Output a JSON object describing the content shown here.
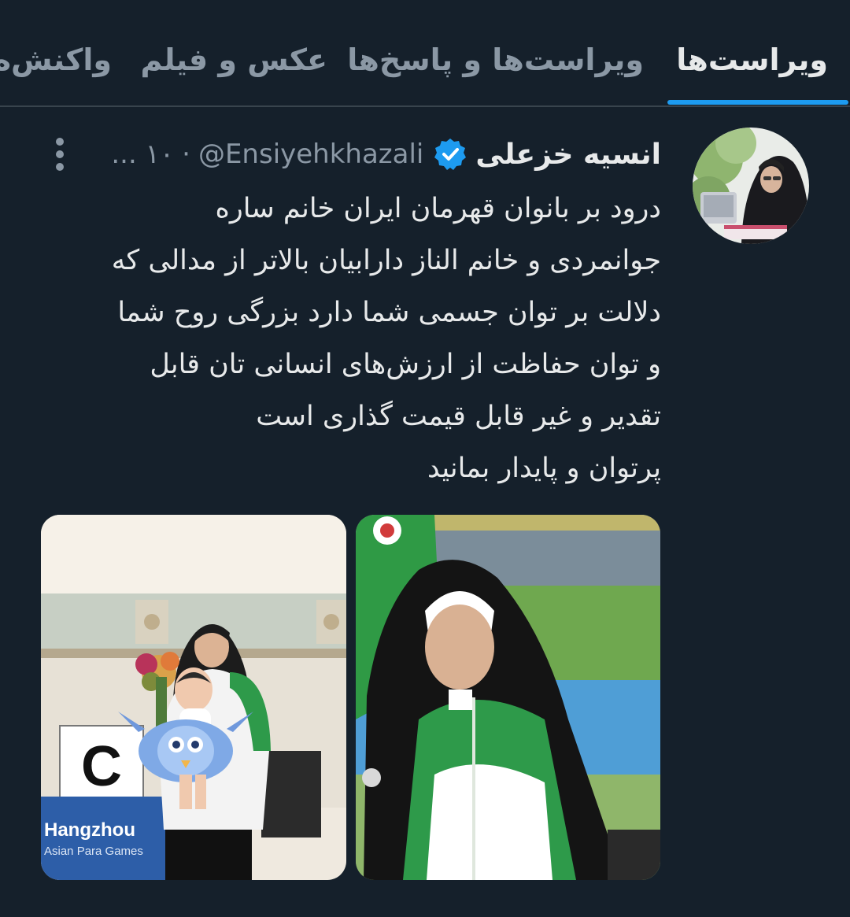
{
  "tabs": [
    {
      "label": "ویراست‌ها",
      "active": true
    },
    {
      "label": "ویراست‌ها و پاسخ‌ها",
      "active": false
    },
    {
      "label": "عکس و فیلم",
      "active": false
    },
    {
      "label": "واکنش‌ه",
      "active": false
    }
  ],
  "tweet": {
    "author_name": "انسیه خزعلی",
    "verified": true,
    "handle": "@Ensiyehkhazali",
    "separator": "·",
    "time": "۱۰ ...",
    "text_lines": [
      "درود بر بانوان قهرمان ایران خانم ساره",
      "جوانمردی و خانم الناز دارابیان بالاتر از مدالی که",
      "دلالت بر توان جسمی شما دارد بزرگی روح شما",
      "و توان حفاظت از ارزش‌های انسانی تان قابل",
      "تقدیر و غیر قابل قیمت گذاری است",
      "پرتوان و پایدار بمانید"
    ],
    "media": [
      {
        "sign_letter": "C",
        "banner_line1": "Hangzhou",
        "banner_line2": "Asian Para Games"
      },
      {}
    ]
  },
  "colors": {
    "background": "#15202b",
    "accent": "#1d9bf0",
    "text_primary": "#e7e9ea",
    "text_secondary": "#8b98a5"
  },
  "icons": [
    "verified-badge-icon",
    "more-options-icon"
  ]
}
